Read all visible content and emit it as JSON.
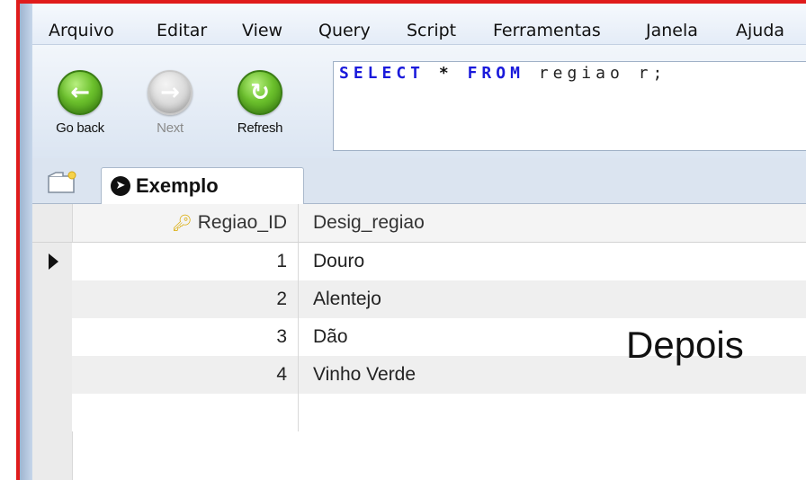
{
  "menu": [
    "Arquivo",
    "Editar",
    "View",
    "Query",
    "Script",
    "Ferramentas",
    "Janela",
    "Ajuda"
  ],
  "toolbar": {
    "go_back": "Go back",
    "next": "Next",
    "refresh": "Refresh"
  },
  "query": {
    "kw_select": "SELECT",
    "star": "*",
    "kw_from": "FROM",
    "table": "regiao r;"
  },
  "tab": {
    "label": "Exemplo"
  },
  "grid": {
    "columns": [
      "Regiao_ID",
      "Desig_regiao"
    ],
    "rows": [
      {
        "id": "1",
        "desig": "Douro"
      },
      {
        "id": "2",
        "desig": "Alentejo"
      },
      {
        "id": "3",
        "desig": "Dão"
      },
      {
        "id": "4",
        "desig": "Vinho Verde"
      }
    ]
  },
  "overlay_text": "Depois"
}
